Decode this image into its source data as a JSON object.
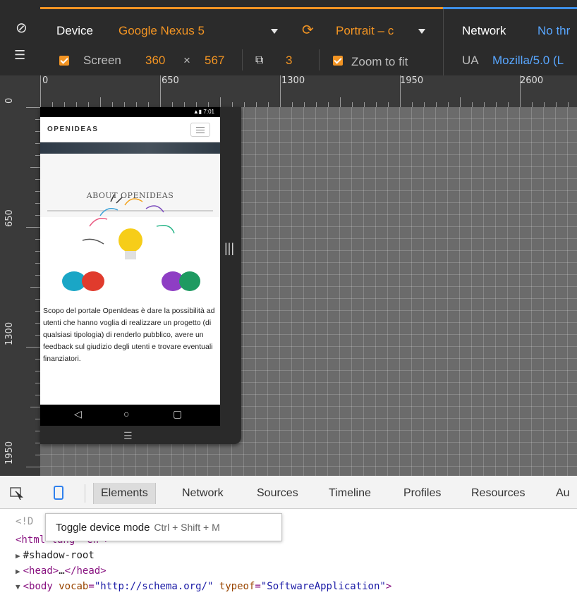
{
  "toolbar": {
    "device_label": "Device",
    "device_value": "Google Nexus 5",
    "orientation_value": "Portrait – c",
    "network_label": "Network",
    "network_value": "No thr",
    "screen_label": "Screen",
    "screen_width": "360",
    "times": "×",
    "screen_height": "567",
    "dpr_value": "3",
    "zoom_label": "Zoom to fit",
    "ua_label": "UA",
    "ua_value": "Mozilla/5.0 (L"
  },
  "ruler": {
    "top_labels": [
      "0",
      "650",
      "1300",
      "1950",
      "2600"
    ],
    "left_labels": [
      "0",
      "650",
      "1300",
      "1950"
    ]
  },
  "phone": {
    "status_time": "7:01",
    "brand": "OPENIDEAS",
    "about_title": "ABOUT OPENIDEAS",
    "description": "Scopo del portale OpenIdeas è dare la possibilità ad utenti che hanno voglia di realizzare un progetto (di qualsiasi tipologia) di renderlo pubblico, avere un feedback sul giudizio degli utenti e trovare eventuali finanziatori."
  },
  "devtools": {
    "tabs": [
      "Elements",
      "Network",
      "Sources",
      "Timeline",
      "Profiles",
      "Resources",
      "Au"
    ],
    "active_tab": "Elements",
    "tooltip_label": "Toggle device mode",
    "tooltip_shortcut": "Ctrl + Shift + M"
  },
  "code": {
    "line1": "<!D",
    "line2_tag": "<html lang=\"en\">",
    "line3": "#shadow-root",
    "line4_open": "<head>",
    "line4_ellipsis": "…",
    "line4_close": "</head>",
    "line5_open": "<body",
    "line5_attr1": "vocab",
    "line5_val1": "\"http://schema.org/\"",
    "line5_attr2": "typeof",
    "line5_val2": "\"SoftwareApplication\"",
    "line5_close": ">"
  },
  "colors": {
    "accent_orange": "#f29423",
    "accent_blue": "#3d8ee6",
    "toolbar_bg": "#2b2b2b"
  }
}
